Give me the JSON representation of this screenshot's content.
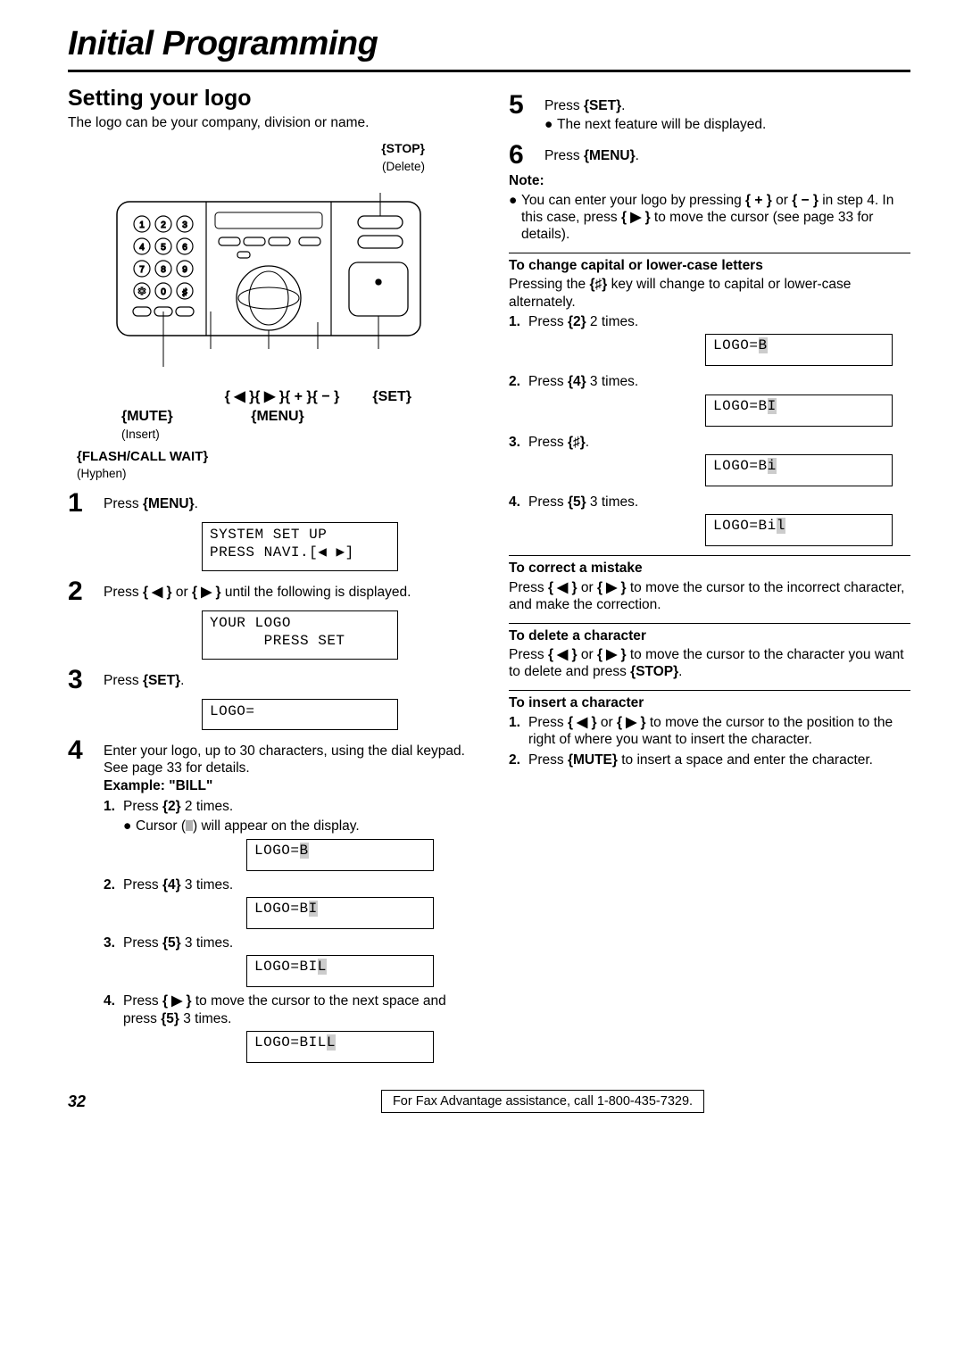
{
  "page_title": "Initial Programming",
  "section_title": "Setting your logo",
  "intro": "The logo can be your company, division or name.",
  "diagram": {
    "stop": "{STOP}",
    "stop_sub": "(Delete)",
    "arrows": "{ ◀ }{ ▶ }{ + }{ − }",
    "set": "{SET}",
    "mute": "{MUTE}",
    "mute_sub": "(Insert)",
    "menu": "{MENU}",
    "flash": "{FLASH/CALL WAIT}",
    "flash_sub": "(Hyphen)"
  },
  "steps_left": {
    "s1": {
      "text_a": "Press ",
      "key": "{MENU}",
      "text_b": "."
    },
    "lcd1": "SYSTEM SET UP\nPRESS NAVI.[◀ ▶]",
    "s2": {
      "text_a": "Press ",
      "k1": "{ ◀ }",
      "mid": " or ",
      "k2": "{ ▶ }",
      "text_b": " until the following is displayed."
    },
    "lcd2": "YOUR LOGO\n      PRESS SET",
    "s3": {
      "text_a": "Press ",
      "key": "{SET}",
      "text_b": "."
    },
    "lcd3": "LOGO=",
    "s4": {
      "intro": "Enter your logo, up to 30 characters, using the dial keypad. See page 33 for details.",
      "example_label": "Example: \"BILL\"",
      "items": [
        {
          "n": "1.",
          "text_a": "Press ",
          "key": "{2}",
          "text_b": " 2 times.",
          "sub_bullet": "Cursor (   ) will appear on the display.",
          "lcd": "LOGO=B"
        },
        {
          "n": "2.",
          "text_a": "Press ",
          "key": "{4}",
          "text_b": " 3 times.",
          "lcd": "LOGO=BI"
        },
        {
          "n": "3.",
          "text_a": "Press ",
          "key": "{5}",
          "text_b": " 3 times.",
          "lcd": "LOGO=BIL"
        },
        {
          "n": "4.",
          "text_a": "Press ",
          "key": "{ ▶ }",
          "text_b": " to move the cursor to the next space and press ",
          "key2": "{5}",
          "text_c": " 3 times.",
          "lcd": "LOGO=BILL"
        }
      ]
    }
  },
  "steps_right": {
    "s5": {
      "text_a": "Press ",
      "key": "{SET}",
      "text_b": ".",
      "bullet": "The next feature will be displayed."
    },
    "s6": {
      "text_a": "Press ",
      "key": "{MENU}",
      "text_b": "."
    },
    "note_label": "Note:",
    "note_text_a": "You can enter your logo by pressing ",
    "note_k1": "{ + }",
    "note_mid1": " or ",
    "note_k2": "{ − }",
    "note_mid2": " in step 4. In this case, press ",
    "note_k3": "{ ▶ }",
    "note_text_b": " to move the cursor (see page 33 for details)."
  },
  "case_section": {
    "heading": "To change capital or lower-case letters",
    "intro_a": "Pressing the ",
    "intro_key": "{♯}",
    "intro_b": " key will change to capital or lower-case alternately.",
    "items": [
      {
        "n": "1.",
        "text_a": "Press ",
        "key": "{2}",
        "text_b": " 2 times.",
        "lcd": "LOGO=B"
      },
      {
        "n": "2.",
        "text_a": "Press ",
        "key": "{4}",
        "text_b": " 3 times.",
        "lcd": "LOGO=BI"
      },
      {
        "n": "3.",
        "text_a": "Press ",
        "key": "{♯}",
        "text_b": ".",
        "lcd": "LOGO=Bi"
      },
      {
        "n": "4.",
        "text_a": "Press ",
        "key": "{5}",
        "text_b": " 3 times.",
        "lcd": "LOGO=Bil"
      }
    ]
  },
  "correct_section": {
    "heading": "To correct a mistake",
    "text_a": "Press ",
    "k1": "{ ◀ }",
    "mid": " or ",
    "k2": "{ ▶ }",
    "text_b": " to move the cursor to the incorrect character, and make the correction."
  },
  "delete_section": {
    "heading": "To delete a character",
    "text_a": "Press ",
    "k1": "{ ◀ }",
    "mid": " or ",
    "k2": "{ ▶ }",
    "text_b": " to move the cursor to the character you want to delete and press ",
    "k3": "{STOP}",
    "text_c": "."
  },
  "insert_section": {
    "heading": "To insert a character",
    "items": [
      {
        "n": "1.",
        "text_a": "Press ",
        "k1": "{ ◀ }",
        "mid": " or ",
        "k2": "{ ▶ }",
        "text_b": " to move the cursor to the position to the right of where you want to insert the character."
      },
      {
        "n": "2.",
        "text_a": "Press ",
        "k1": "{MUTE}",
        "text_b": " to insert a space and enter the character."
      }
    ]
  },
  "footer": {
    "page": "32",
    "text": "For Fax Advantage assistance, call 1-800-435-7329."
  }
}
